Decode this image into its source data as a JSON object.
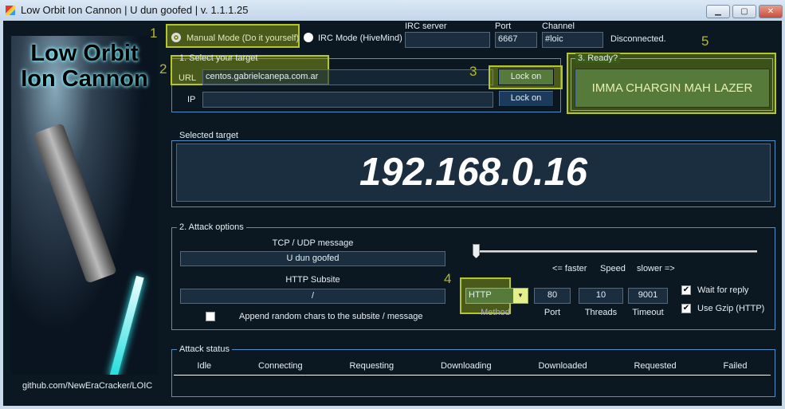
{
  "window": {
    "title": "Low Orbit Ion Cannon | U dun goofed | v. 1.1.1.25",
    "min": "▁",
    "max": "▢",
    "close": "✕"
  },
  "logo": {
    "line1": "Low Orbit",
    "line2": "Ion Cannon",
    "footer": "github.com/NewEraCracker/LOIC"
  },
  "mode": {
    "manual": "Manual Mode (Do it yourself)",
    "irc": "IRC Mode (HiveMind)",
    "selected": "manual"
  },
  "irc": {
    "server_label": "IRC server",
    "server": "",
    "port_label": "Port",
    "port": "6667",
    "channel_label": "Channel",
    "channel": "#loic",
    "status": "Disconnected."
  },
  "target": {
    "group": "1. Select your target",
    "url_label": "URL",
    "url": "centos.gabrielcanepa.com.ar",
    "ip_label": "IP",
    "ip": "",
    "lock_url": "Lock on",
    "lock_ip": "Lock on"
  },
  "ready": {
    "group": "3. Ready?",
    "fire": "IMMA CHARGIN MAH LAZER"
  },
  "selected": {
    "group": "Selected target",
    "value": "192.168.0.16"
  },
  "attack": {
    "group": "2. Attack options",
    "tcp_label": "TCP / UDP message",
    "tcp": "U dun goofed",
    "http_label": "HTTP Subsite",
    "http": "/",
    "append": "Append random chars to the subsite / message",
    "append_checked": false,
    "speed_faster": "<= faster",
    "speed": "Speed",
    "speed_slower": "slower =>",
    "speed_value": 0,
    "method": "HTTP",
    "method_label": "Method",
    "port": "80",
    "port_label": "Port",
    "threads": "10",
    "threads_label": "Threads",
    "timeout": "9001",
    "timeout_label": "Timeout",
    "wait": "Wait for reply",
    "wait_checked": true,
    "gzip": "Use Gzip (HTTP)",
    "gzip_checked": true
  },
  "status": {
    "group": "Attack status",
    "columns": [
      "Idle",
      "Connecting",
      "Requesting",
      "Downloading",
      "Downloaded",
      "Requested",
      "Failed"
    ]
  },
  "annotations": [
    "1",
    "2",
    "3",
    "4",
    "5"
  ],
  "colors": {
    "bg": "#0c1821",
    "highlight": "#b6c62a",
    "group_border": "#4d8fc9"
  }
}
